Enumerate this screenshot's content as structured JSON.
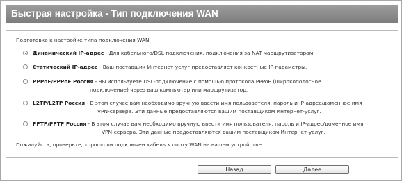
{
  "page": {
    "title": "Быстрая настройка - Тип подключения WAN",
    "intro": "Подготовка к настройке типа подключения WAN.",
    "note": "Пожалуйста, проверьте, хорошо ли подключен кабель к порту WAN на вашем устройстве."
  },
  "options": [
    {
      "name": "Динамический IP-адрес",
      "desc": " - Для кабельного/DSL-подключения, подключения за NAT-маршрутизатором.",
      "desc2": "",
      "checked": true
    },
    {
      "name": "Статический IP-адрес",
      "desc": " - Ваш поставщик Интернет-услуг предоставляет конкретные IP-параметры.",
      "desc2": "",
      "checked": false
    },
    {
      "name": "PPPoE/PPPoE Россия",
      "desc": " - Вы используете DSL-подключение с помощью протокола PPPoE (широкополосное",
      "desc2": "подключение) через ваш компьютер или маршрутизатор.",
      "checked": false
    },
    {
      "name": "L2TP/L2TP Россия",
      "desc": " - В этом случае вам необходимо вручную ввести имя пользователя, пароль и IP-адрес/доменное имя",
      "desc2": "VPN-сервера. Эти данные предоставляются вашим поставщиком  Интернет-услуг.",
      "checked": false
    },
    {
      "name": "PPTP/PPTP Россия",
      "desc": " - В этом случае вам необходимо вручную ввести имя пользователя, пароль и IP-адрес/доменное имя",
      "desc2": "VPN-сервера. Эти данные предоставляются вашим поставщиком  Интернет-услуг.",
      "checked": false
    }
  ],
  "buttons": {
    "back": "Назад",
    "next": "Далее"
  }
}
